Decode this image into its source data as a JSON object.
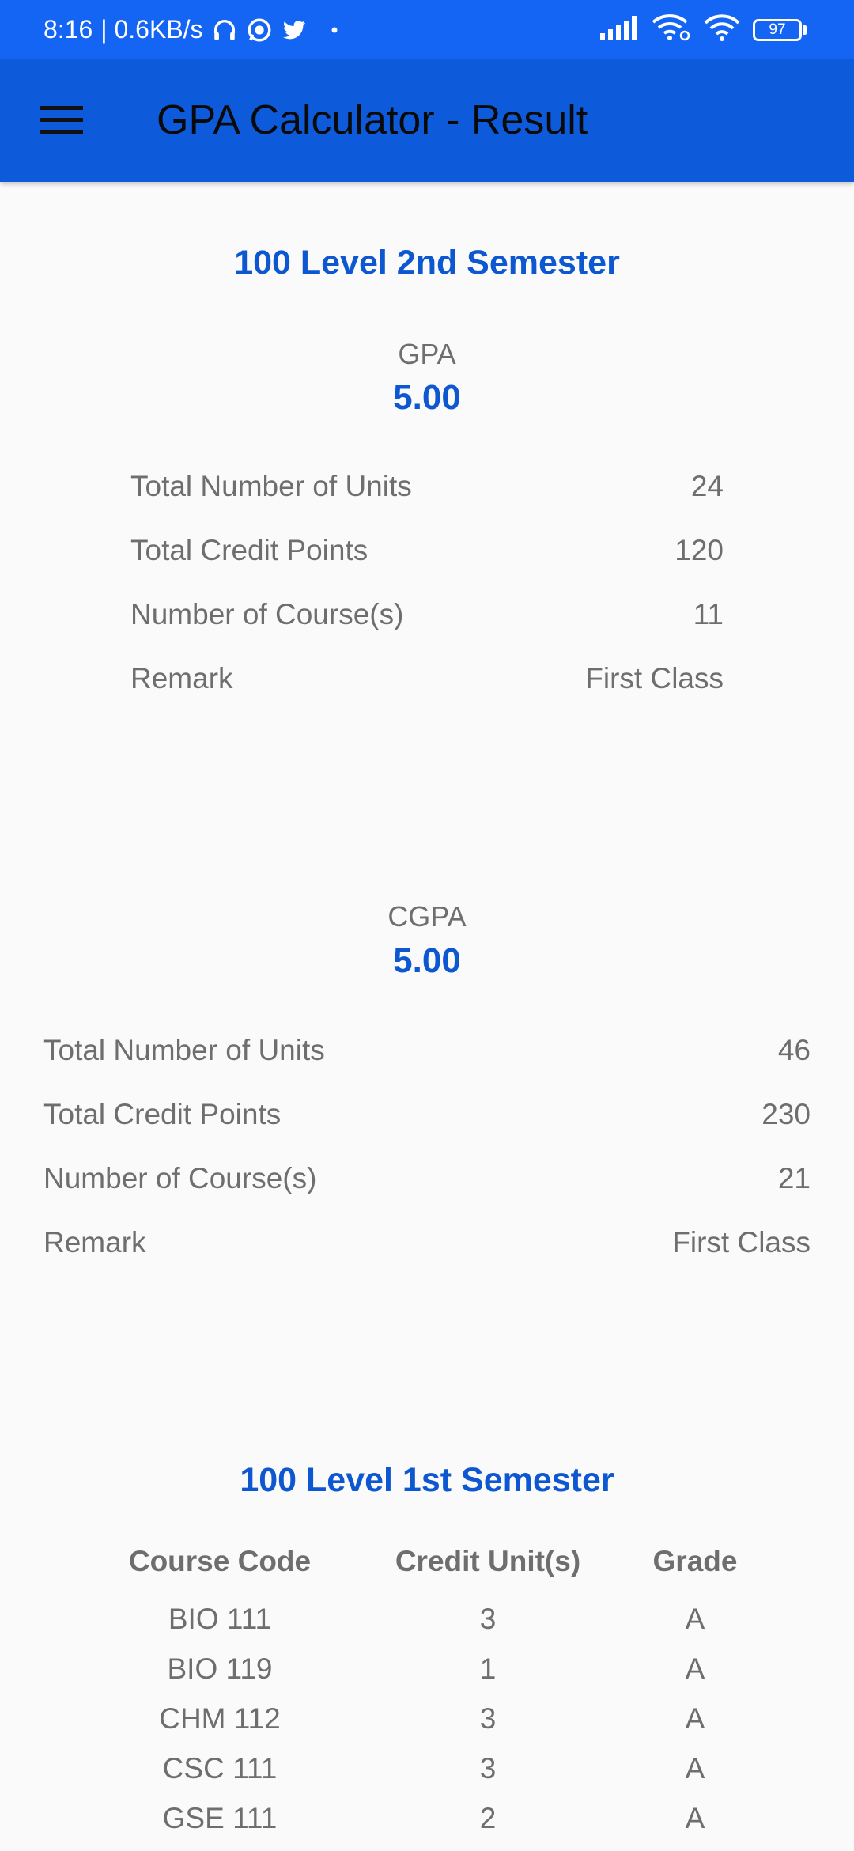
{
  "status_bar": {
    "time": "8:16",
    "speed": "| 0.6KB/s",
    "battery": "97",
    "icons": [
      "headphones-icon",
      "whatsapp-icon",
      "twitter-icon",
      "dot-icon",
      "signal-icon",
      "wifi-call-icon",
      "wifi-icon",
      "battery-icon"
    ]
  },
  "app_bar": {
    "title": "GPA Calculator - Result",
    "menu_icon": "menu-icon"
  },
  "semester": {
    "heading": "100 Level 2nd Semester",
    "gpa_label": "GPA",
    "gpa_value": "5.00",
    "rows": [
      {
        "label": "Total Number of Units",
        "value": "24"
      },
      {
        "label": "Total Credit Points",
        "value": "120"
      },
      {
        "label": "Number of Course(s)",
        "value": "11"
      },
      {
        "label": "Remark",
        "value": "First Class"
      }
    ]
  },
  "cumulative": {
    "cgpa_label": "CGPA",
    "cgpa_value": "5.00",
    "rows": [
      {
        "label": "Total Number of Units",
        "value": "46"
      },
      {
        "label": "Total Credit Points",
        "value": "230"
      },
      {
        "label": "Number of Course(s)",
        "value": "21"
      },
      {
        "label": "Remark",
        "value": "First Class"
      }
    ]
  },
  "first_semester": {
    "heading": "100 Level 1st Semester",
    "columns": [
      "Course Code",
      "Credit Unit(s)",
      "Grade"
    ],
    "courses": [
      {
        "code": "BIO 111",
        "units": "3",
        "grade": "A"
      },
      {
        "code": "BIO 119",
        "units": "1",
        "grade": "A"
      },
      {
        "code": "CHM 112",
        "units": "3",
        "grade": "A"
      },
      {
        "code": "CSC 111",
        "units": "3",
        "grade": "A"
      },
      {
        "code": "GSE 111",
        "units": "2",
        "grade": "A"
      }
    ]
  },
  "colors": {
    "status_bar": "#1565f5",
    "app_bar": "#0d5bdb",
    "accent": "#0d57d1",
    "text_gray": "#6e6e6e",
    "background": "#fafafa"
  }
}
